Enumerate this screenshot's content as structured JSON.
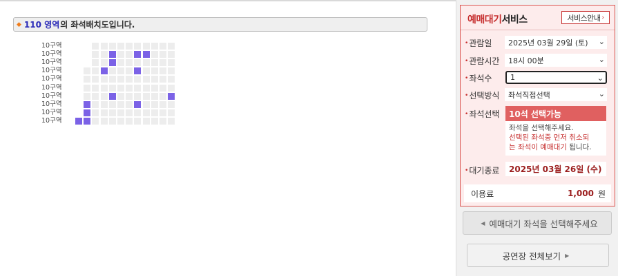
{
  "area": {
    "bullet": "◆",
    "zone": "110 영역",
    "suffix": "의 좌석배치도입니다."
  },
  "seat_map": {
    "rows": [
      {
        "label": "10구역",
        "seats": "..eeeeeeeeee"
      },
      {
        "label": "10구역",
        "seats": "..eeaeeaaeee"
      },
      {
        "label": "10구역",
        "seats": "..eeaeeeeeee"
      },
      {
        "label": "10구역",
        "seats": ".eeaeeeaeeee"
      },
      {
        "label": "10구역",
        "seats": ".eeeeeeeeeee"
      },
      {
        "label": "10구역",
        "seats": ".eeeeeeeeeee"
      },
      {
        "label": "10구역",
        "seats": ".eeeaeeeeeea"
      },
      {
        "label": "10구역",
        "seats": ".aeeeeeaeeee"
      },
      {
        "label": "10구역",
        "seats": ".aeeeeeeeeee"
      },
      {
        "label": "10구역",
        "seats": "aaeeeeeeeeee"
      }
    ],
    "colors": {
      "available": "#7b62e6",
      "empty": "#ededed"
    }
  },
  "panel": {
    "title_red": "예매대기",
    "title_dark": "서비스",
    "guide_button": "서비스안내",
    "guide_arrow": "›",
    "fields": {
      "date_label": "관람일",
      "date_value": "2025년 03월 29일 (토)",
      "time_label": "관람시간",
      "time_value": "18시 00분",
      "count_label": "좌석수",
      "count_value": "1",
      "method_label": "선택방식",
      "method_value": "좌석직접선택",
      "seat_label": "좌석선택",
      "end_label": "대기종료"
    },
    "status": {
      "header": "10석 선택가능",
      "line1": "좌석을 선택해주세요.",
      "line2_warn": "선택된 좌석중 먼저 취소되",
      "line3_warn": "는 좌석이 예매대기",
      "line3_rest": " 됩니다."
    },
    "end_date": "2025년 03월 26일 (수)",
    "fee": {
      "label": "이용료",
      "amount": "1,000",
      "unit": "원"
    }
  },
  "buttons": {
    "select_seat": "예매대기 좌석을 선택해주세요",
    "view_all": "공연장 전체보기"
  },
  "colors": {
    "accent": "#c62f2f",
    "panel_bg": "#fdecec",
    "status_head": "#e06060"
  }
}
